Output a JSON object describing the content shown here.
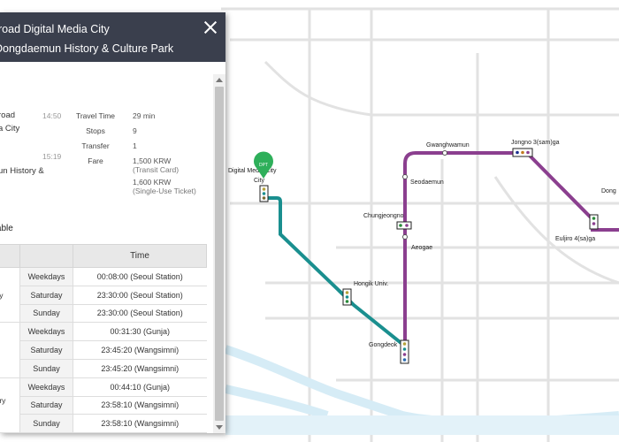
{
  "panel": {
    "route_from": "road Digital Media City",
    "route_to": "Dongdaemun History & Culture Park",
    "origin": {
      "line1": "road",
      "line2": "a City",
      "time": "14:50"
    },
    "destination": {
      "line1": "un History &",
      "line2": "",
      "time": "15:19"
    },
    "summary": {
      "travel_time_label": "Travel Time",
      "travel_time": "29 min",
      "stops_label": "Stops",
      "stops": "9",
      "transfer_label": "Transfer",
      "transfer": "1",
      "fare_label": "Fare",
      "fare_card": "1,500 KRW",
      "fare_card_note": "(Transit Card)",
      "fare_ticket": "1,600 KRW",
      "fare_ticket_note": "(Single-Use Ticket)"
    },
    "timetable_title": "netable",
    "timetable": {
      "header_time": "Time",
      "groups": [
        {
          "station": "City",
          "rows": [
            {
              "day": "Weekdays",
              "time": "00:08:00 (Seoul Station)"
            },
            {
              "day": "Saturday",
              "time": "23:30:00 (Seoul Station)"
            },
            {
              "day": "Sunday",
              "time": "23:30:00 (Seoul Station)"
            }
          ]
        },
        {
          "station": "",
          "rows": [
            {
              "day": "Weekdays",
              "time": "00:31:30 (Gunja)"
            },
            {
              "day": "Saturday",
              "time": "23:45:20 (Wangsimni)"
            },
            {
              "day": "Sunday",
              "time": "23:45:20 (Wangsimni)"
            }
          ]
        },
        {
          "station": "istory\nk",
          "rows": [
            {
              "day": "Weekdays",
              "time": "00:44:10 (Gunja)"
            },
            {
              "day": "Saturday",
              "time": "23:58:10 (Wangsimni)"
            },
            {
              "day": "Sunday",
              "time": "23:58:10 (Wangsimni)"
            }
          ]
        }
      ]
    }
  },
  "map": {
    "departure_marker": "DPT",
    "stations": {
      "dmc": "Digital Media City",
      "hongik": "Hongik Univ.",
      "gongdeok": "Gongdeok",
      "ahyeon": "Aeogae",
      "chungjeongno": "Chungjeongno",
      "seodaemun": "Seodaemun",
      "gwanghwamun": "Gwanghwamun",
      "jongno3": "Jongno 3(sam)ga",
      "euljiro4": "Euljiro 4(sa)ga",
      "dongdaemun": "Dong"
    },
    "colors": {
      "line6": "#1a8f8f",
      "line5": "#8b3f8f",
      "marker": "#2eaf5a",
      "header": "#3a3f4d"
    }
  }
}
